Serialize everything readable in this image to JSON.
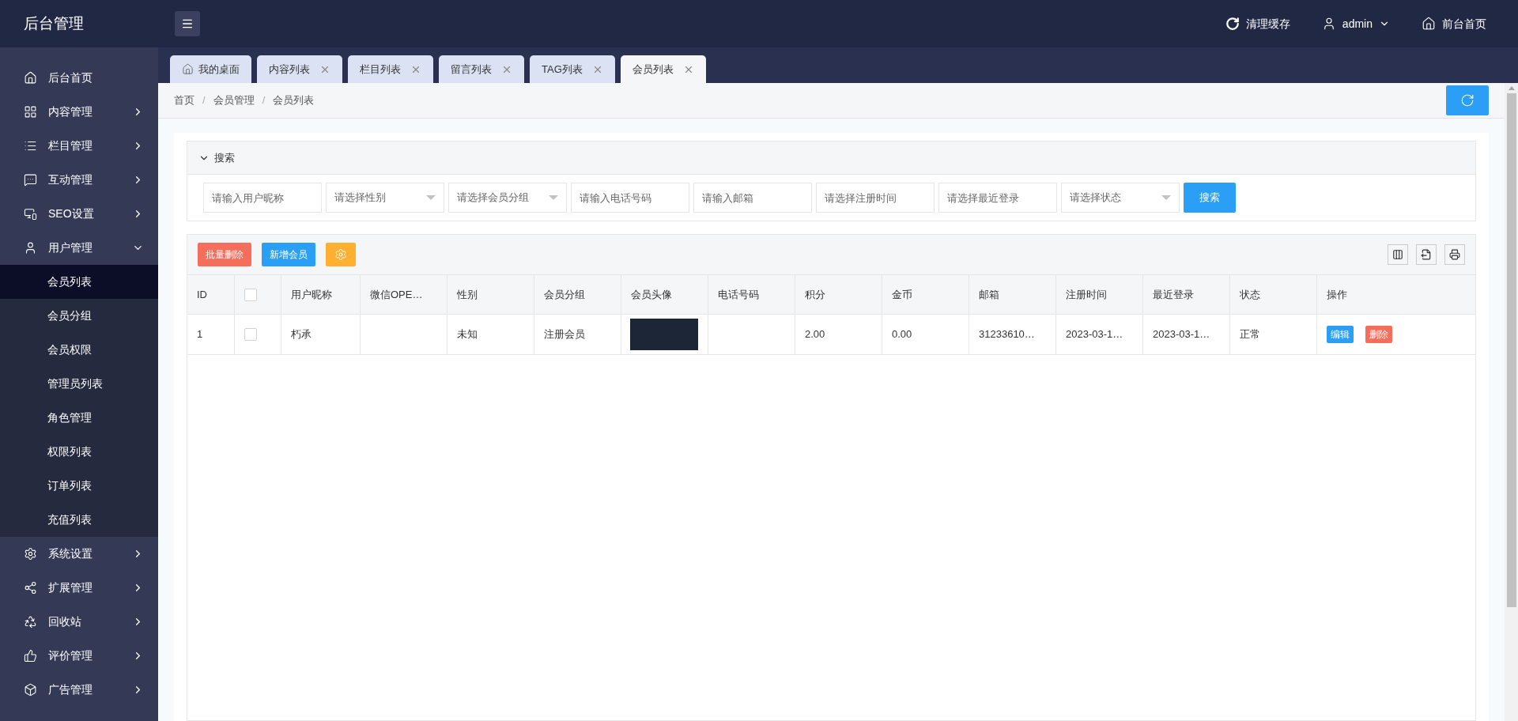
{
  "header": {
    "logo": "后台管理",
    "actions": [
      {
        "kind": "refresh",
        "label": "清理缓存"
      },
      {
        "kind": "user",
        "label": "admin"
      },
      {
        "kind": "home",
        "label": "前台首页"
      }
    ]
  },
  "sidebar": {
    "items": [
      {
        "label": "后台首页",
        "kind": "link"
      },
      {
        "label": "内容管理",
        "kind": "menu",
        "expanded": false
      },
      {
        "label": "栏目管理",
        "kind": "menu",
        "expanded": false
      },
      {
        "label": "互动管理",
        "kind": "menu",
        "expanded": false
      },
      {
        "label": "SEO设置",
        "kind": "menu",
        "expanded": false
      },
      {
        "label": "用户管理",
        "kind": "menu",
        "expanded": true,
        "children": [
          {
            "label": "会员列表",
            "selected": true
          },
          {
            "label": "会员分组",
            "selected": false
          },
          {
            "label": "会员权限",
            "selected": false
          },
          {
            "label": "管理员列表",
            "selected": false
          },
          {
            "label": "角色管理",
            "selected": false
          },
          {
            "label": "权限列表",
            "selected": false
          },
          {
            "label": "订单列表",
            "selected": false
          },
          {
            "label": "充值列表",
            "selected": false
          }
        ]
      },
      {
        "label": "系统设置",
        "kind": "menu",
        "expanded": false
      },
      {
        "label": "扩展管理",
        "kind": "menu",
        "expanded": false
      },
      {
        "label": "回收站",
        "kind": "menu",
        "expanded": false
      },
      {
        "label": "评价管理",
        "kind": "menu",
        "expanded": false
      },
      {
        "label": "广告管理",
        "kind": "menu",
        "expanded": false
      }
    ]
  },
  "tabs": [
    {
      "label": "我的桌面",
      "kind": "home",
      "selected": false
    },
    {
      "label": "内容列表",
      "kind": "closable",
      "selected": false
    },
    {
      "label": "栏目列表",
      "kind": "closable",
      "selected": false
    },
    {
      "label": "留言列表",
      "kind": "closable",
      "selected": false
    },
    {
      "label": "TAG列表",
      "kind": "closable",
      "selected": false
    },
    {
      "label": "会员列表",
      "kind": "closable",
      "selected": true
    }
  ],
  "breadcrumb": {
    "separator": "/",
    "items": [
      "首页",
      "会员管理",
      "会员列表"
    ]
  },
  "search": {
    "title": "搜索",
    "expanded": true,
    "fields": [
      {
        "kind": "input",
        "placeholder": "请输入用户昵称"
      },
      {
        "kind": "select",
        "placeholder": "请选择性别"
      },
      {
        "kind": "select",
        "placeholder": "请选择会员分组"
      },
      {
        "kind": "input",
        "placeholder": "请输入电话号码"
      },
      {
        "kind": "input",
        "placeholder": "请输入邮箱"
      },
      {
        "kind": "input",
        "placeholder": "请选择注册时间"
      },
      {
        "kind": "input",
        "placeholder": "请选择最近登录"
      },
      {
        "kind": "select",
        "placeholder": "请选择状态"
      }
    ],
    "button": "搜索"
  },
  "toolbar": {
    "buttons": [
      {
        "kind": "danger",
        "label": "批量删除"
      },
      {
        "kind": "primary",
        "label": "新增会员"
      },
      {
        "kind": "settings"
      }
    ]
  },
  "table": {
    "columns": [
      "ID",
      "",
      "用户昵称",
      "微信OPE…",
      "性别",
      "会员分组",
      "会员头像",
      "电话号码",
      "积分",
      "金币",
      "邮箱",
      "注册时间",
      "最近登录",
      "状态",
      "操作"
    ],
    "header_checked": false,
    "rows": [
      {
        "selected": false,
        "cells": [
          "1",
          "",
          "朽承",
          "",
          "未知",
          "注册会员",
          "",
          "",
          "2.00",
          "0.00",
          "31233610…",
          "2023-03-1…",
          "2023-03-1…",
          "正常",
          ""
        ],
        "actions": [
          {
            "kind": "edit",
            "label": "编辑"
          },
          {
            "kind": "delete",
            "label": "删除"
          }
        ]
      }
    ]
  }
}
